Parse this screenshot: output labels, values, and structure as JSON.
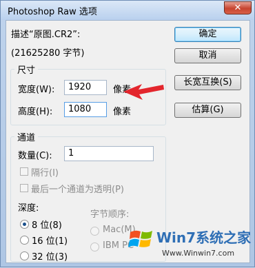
{
  "window": {
    "title": "Photoshop Raw 选项",
    "close_symbol": "✕"
  },
  "description": {
    "line1": "描述“原图.CR2”:",
    "line2": "(21625280 字节)"
  },
  "size_group": {
    "title": "尺寸",
    "width_label": "宽度(W):",
    "width_value": "1920",
    "width_unit": "像素",
    "height_label": "高度(H):",
    "height_value": "1080",
    "height_unit": "像素"
  },
  "buttons": {
    "ok": "确定",
    "cancel": "取消",
    "swap": "长宽互换(S)",
    "guess": "估算(G)"
  },
  "channel_group": {
    "title": "通道",
    "count_label": "数量(C):",
    "count_value": "1",
    "interleaved_label": "隔行(I)",
    "last_alpha_label": "最后一个通道为透明(P)"
  },
  "depth": {
    "label": "深度:",
    "options": [
      "8 位(8)",
      "16 位(1)",
      "32 位(3)"
    ],
    "selected": "8 位(8)"
  },
  "byte_order": {
    "label": "字节顺序:",
    "options": [
      "Mac(M)",
      "IBM PC"
    ]
  },
  "watermark": {
    "brand": "Win7系统之家",
    "url": "Www.Winwin7.com"
  },
  "colors": {
    "annotation_arrow": "#e3262d",
    "title_bar": "#c9daf0"
  }
}
